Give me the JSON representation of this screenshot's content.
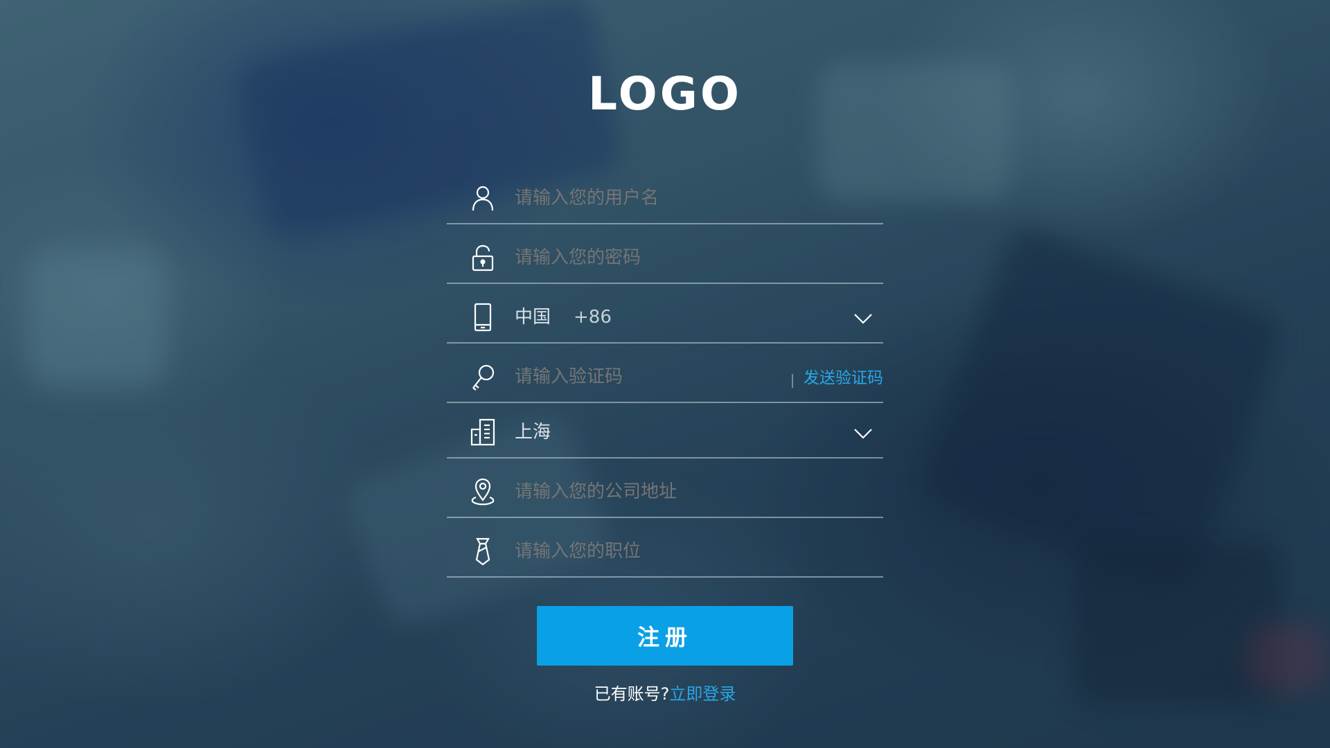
{
  "logo": {
    "text": "LOGO"
  },
  "form": {
    "username": {
      "placeholder": "请输入您的用户名",
      "icon": "user-icon"
    },
    "password": {
      "placeholder": "请输入您的密码",
      "icon": "lock-icon"
    },
    "phone": {
      "country": "中国",
      "code": "+86",
      "icon": "phone-icon",
      "chevron": "chevron-down-icon"
    },
    "verification": {
      "placeholder": "请输入验证码",
      "send_label": "发送验证码",
      "icon": "key-icon"
    },
    "city": {
      "value": "上海",
      "icon": "building-icon",
      "chevron": "chevron-down-icon"
    },
    "address": {
      "placeholder": "请输入您的公司地址",
      "icon": "location-pin-icon"
    },
    "position": {
      "placeholder": "请输入您的职位",
      "icon": "tie-icon"
    }
  },
  "submit": {
    "label": "注册"
  },
  "login": {
    "prompt": "已有账号?",
    "link": "立即登录"
  },
  "colors": {
    "accent": "#0aa0e6",
    "link": "#29a7e8",
    "text": "#ffffff"
  }
}
